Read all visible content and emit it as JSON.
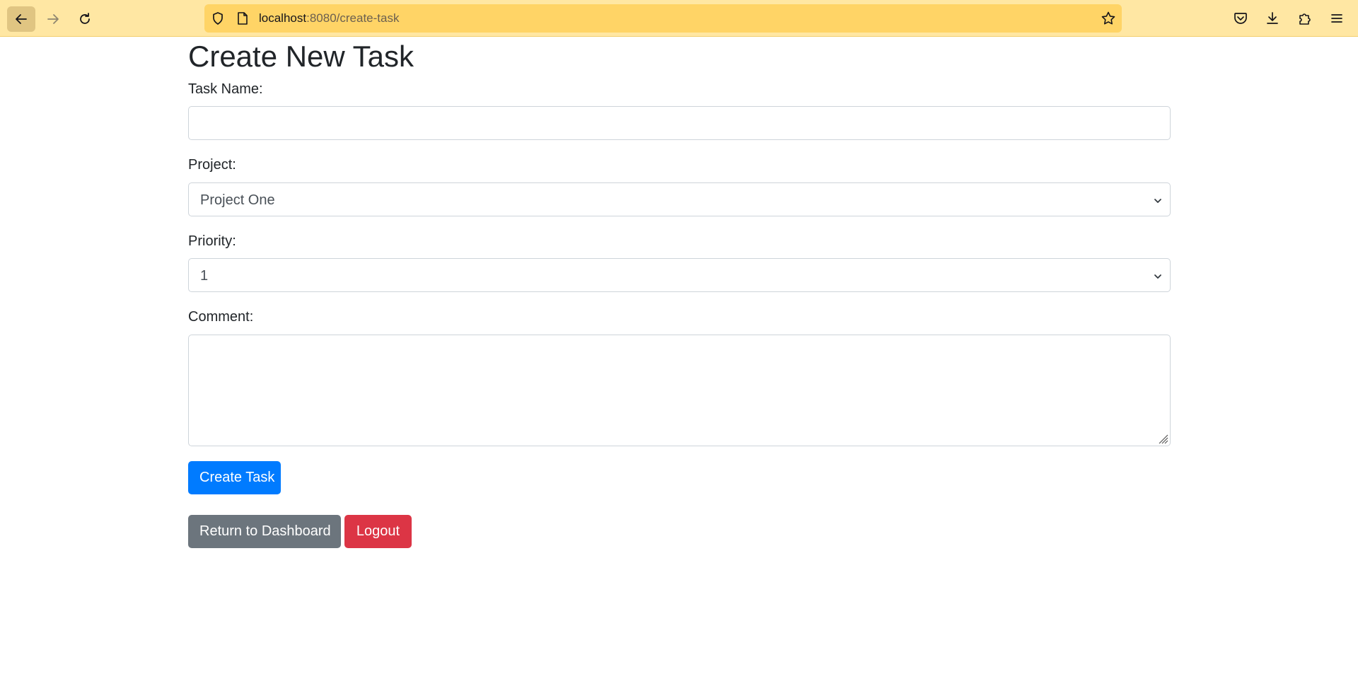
{
  "browser": {
    "url_host": "localhost",
    "url_path": ":8080/create-task",
    "icons": {
      "back": "arrow-left-icon",
      "forward": "arrow-right-icon",
      "reload": "reload-icon",
      "shield": "shield-icon",
      "page": "page-icon",
      "bookmark": "star-icon",
      "pocket": "pocket-icon",
      "downloads": "download-icon",
      "extensions": "puzzle-icon",
      "menu": "hamburger-menu-icon"
    },
    "toolbar_color": "#ffe7a3",
    "urlbar_color": "#ffd466"
  },
  "page": {
    "title": "Create New Task",
    "form": {
      "task_name_label": "Task Name:",
      "task_name_value": "",
      "project_label": "Project:",
      "project_selected": "Project One",
      "priority_label": "Priority:",
      "priority_selected": "1",
      "comment_label": "Comment:",
      "comment_value": ""
    },
    "buttons": {
      "create_task": "Create Task",
      "return_dashboard": "Return to Dashboard",
      "logout": "Logout"
    },
    "colors": {
      "primary": "#007bff",
      "secondary": "#6c757d",
      "danger": "#dc3545"
    }
  }
}
